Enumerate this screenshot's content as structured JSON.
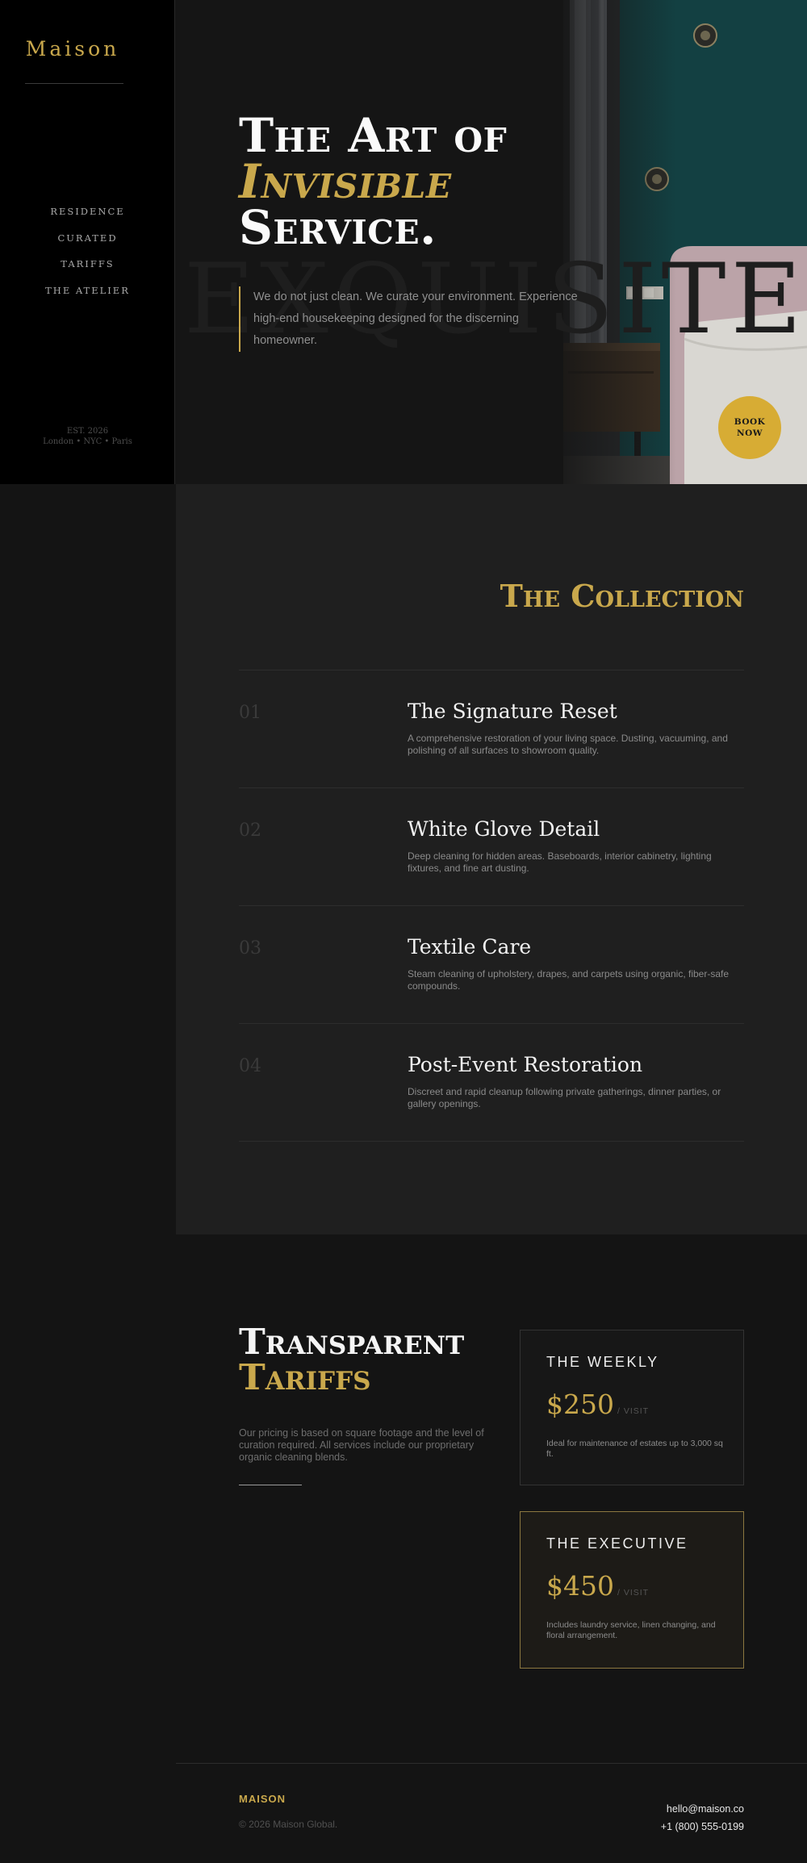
{
  "sidebar": {
    "logo": "Maison",
    "nav": [
      "RESIDENCE",
      "CURATED",
      "TARIFFS",
      "THE ATELIER"
    ],
    "est": "EST. 2026",
    "cities": "London • NYC • Paris"
  },
  "hero": {
    "title_line1": "The Art of",
    "title_line2": "Invisible",
    "title_line3": "Service.",
    "watermark": "EXQUISITE",
    "quote": "We do not just clean. We curate your environment. Experience high-end housekeeping designed for the discerning homeowner.",
    "book_button": "BOOK NOW",
    "colors": {
      "accent": "#c9a84c",
      "button": "#d7ac34",
      "wall": "#13383a"
    }
  },
  "collection": {
    "title": "The Collection",
    "services": [
      {
        "num": "01",
        "name": "The Signature Reset",
        "desc": "A comprehensive restoration of your living space. Dusting, vacuuming, and polishing of all surfaces to showroom quality."
      },
      {
        "num": "02",
        "name": "White Glove Detail",
        "desc": "Deep cleaning for hidden areas. Baseboards, interior cabinetry, lighting fixtures, and fine art dusting."
      },
      {
        "num": "03",
        "name": "Textile Care",
        "desc": "Steam cleaning of upholstery, drapes, and carpets using organic, fiber-safe compounds."
      },
      {
        "num": "04",
        "name": "Post-Event Restoration",
        "desc": "Discreet and rapid cleanup following private gatherings, dinner parties, or gallery openings."
      }
    ]
  },
  "tariffs": {
    "title_line1": "Transparent",
    "title_line2": "Tariffs",
    "desc": "Our pricing is based on square footage and the level of curation required. All services include our proprietary organic cleaning blends.",
    "plans": [
      {
        "name": "THE WEEKLY",
        "price": "$250",
        "per": "/ VISIT",
        "desc": "Ideal for maintenance of estates up to 3,000 sq ft."
      },
      {
        "name": "THE EXECUTIVE",
        "price": "$450",
        "per": "/ VISIT",
        "desc": "Includes laundry service, linen changing, and floral arrangement."
      }
    ]
  },
  "footer": {
    "brand": "MAISON",
    "copyright": "© 2026 Maison Global.",
    "email": "hello@maison.co",
    "phone": "+1 (800) 555-0199"
  }
}
